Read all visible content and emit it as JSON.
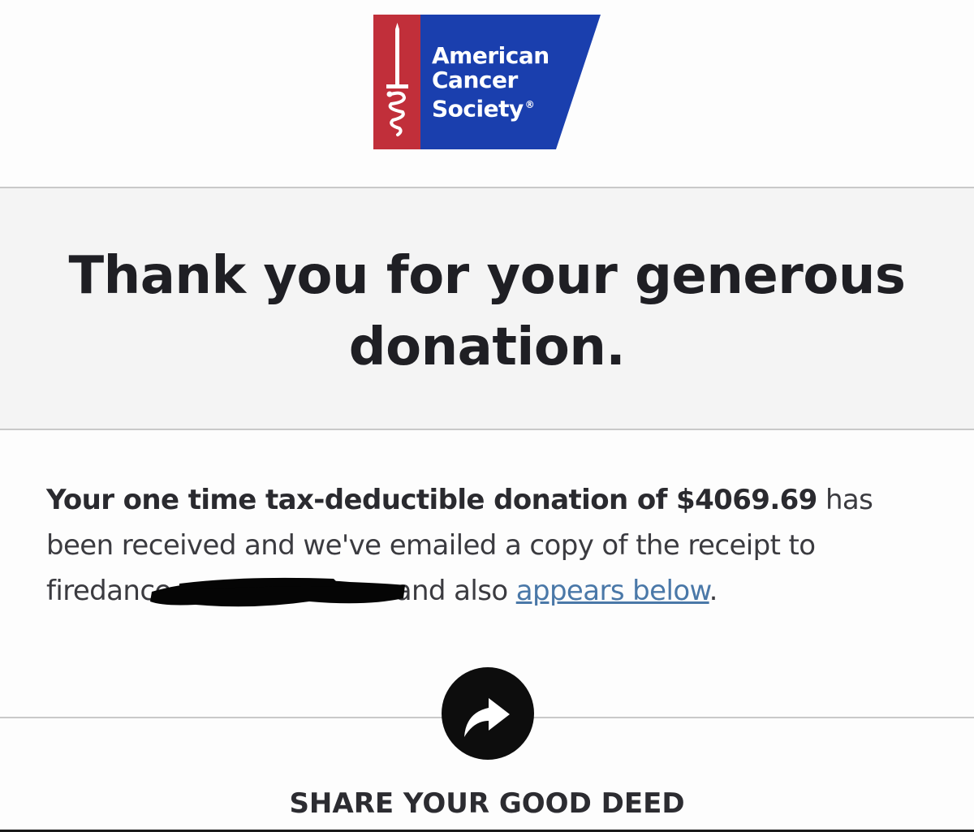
{
  "logo": {
    "line1": "American",
    "line2": "Cancer",
    "line3": "Society",
    "registered": "®",
    "colors": {
      "red": "#c12f3a",
      "blue": "#1a3fae"
    }
  },
  "hero": {
    "title": "Thank you for your generous donation."
  },
  "message": {
    "bold_text": "Your one time tax-deductible donation of $4069.69",
    "text_after_bold": " has been received and we've emailed a copy of the receipt to ",
    "email_prefix": "firedance",
    "text_after_email": "and also ",
    "link_text": "appears below",
    "end_punct": "."
  },
  "share": {
    "icon": "share-arrow-icon",
    "label": "SHARE YOUR GOOD DEED"
  },
  "colors": {
    "hero_bg": "#f4f4f4",
    "link": "#4a78a8",
    "text": "#1f1f24"
  }
}
